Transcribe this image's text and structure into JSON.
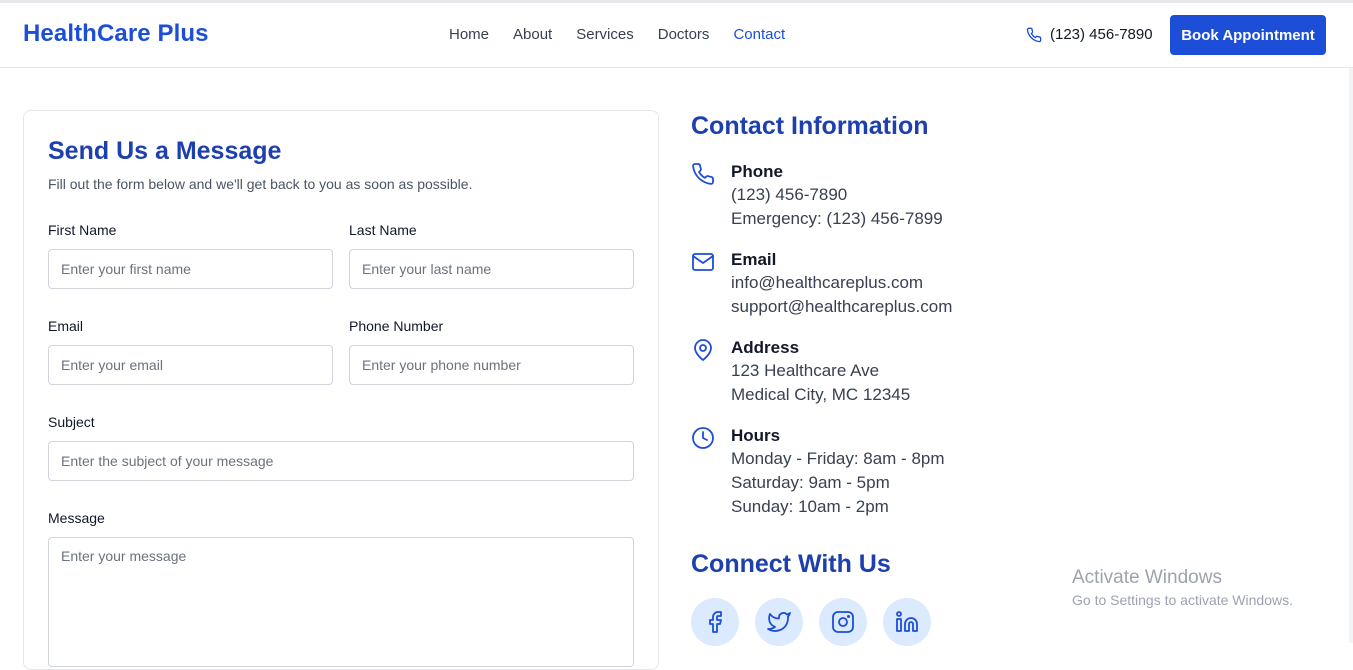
{
  "header": {
    "logo": "HealthCare Plus",
    "nav": [
      "Home",
      "About",
      "Services",
      "Doctors",
      "Contact"
    ],
    "active_nav": "Contact",
    "phone": "(123) 456-7890",
    "book_button": "Book Appointment"
  },
  "form": {
    "title": "Send Us a Message",
    "subtitle": "Fill out the form below and we'll get back to you as soon as possible.",
    "first_name": {
      "label": "First Name",
      "placeholder": "Enter your first name"
    },
    "last_name": {
      "label": "Last Name",
      "placeholder": "Enter your last name"
    },
    "email": {
      "label": "Email",
      "placeholder": "Enter your email"
    },
    "phone": {
      "label": "Phone Number",
      "placeholder": "Enter your phone number"
    },
    "subject": {
      "label": "Subject",
      "placeholder": "Enter the subject of your message"
    },
    "message": {
      "label": "Message",
      "placeholder": "Enter your message"
    }
  },
  "contact": {
    "title": "Contact Information",
    "phone": {
      "heading": "Phone",
      "lines": [
        "(123) 456-7890",
        "Emergency: (123) 456-7899"
      ]
    },
    "email": {
      "heading": "Email",
      "lines": [
        "info@healthcareplus.com",
        "support@healthcareplus.com"
      ]
    },
    "address": {
      "heading": "Address",
      "lines": [
        "123 Healthcare Ave",
        "Medical City, MC 12345"
      ]
    },
    "hours": {
      "heading": "Hours",
      "lines": [
        "Monday - Friday: 8am - 8pm",
        "Saturday: 9am - 5pm",
        "Sunday: 10am - 2pm"
      ]
    }
  },
  "connect": {
    "title": "Connect With Us",
    "icons": [
      "facebook-icon",
      "twitter-icon",
      "instagram-icon",
      "linkedin-icon"
    ]
  },
  "watermark": {
    "line1": "Activate Windows",
    "line2": "Go to Settings to activate Windows."
  },
  "colors": {
    "primary": "#1d4ed8",
    "heading": "#1e40af",
    "social_bg": "#dbeafe"
  }
}
